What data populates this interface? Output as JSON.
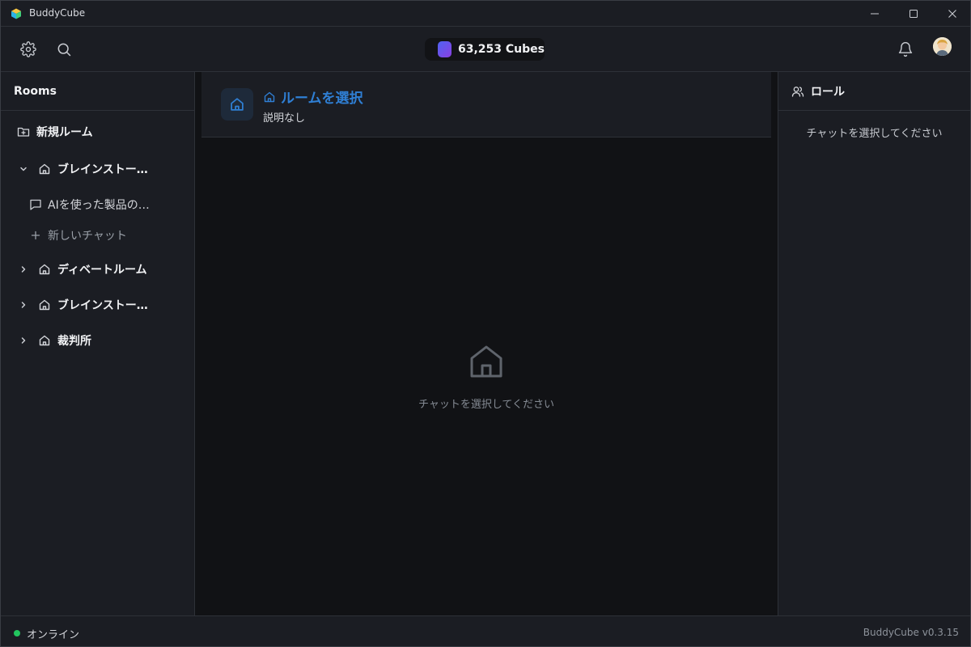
{
  "window": {
    "title": "BuddyCube"
  },
  "toolbar": {
    "cubes": "63,253 Cubes"
  },
  "sidebar": {
    "header": "Rooms",
    "new_room": "新規ルーム",
    "rooms": [
      {
        "name": "ブレインストー…",
        "expanded": true
      },
      {
        "name": "ディベートルーム",
        "expanded": false
      },
      {
        "name": "ブレインストー…",
        "expanded": false
      },
      {
        "name": "裁判所",
        "expanded": false
      }
    ],
    "chats": [
      {
        "label": "AIを使った製品の…"
      }
    ],
    "new_chat": "新しいチャット"
  },
  "room": {
    "title": "ルームを選択",
    "description": "説明なし",
    "empty_message": "チャットを選択してください"
  },
  "roles": {
    "title": "ロール",
    "empty_message": "チャットを選択してください"
  },
  "status": {
    "text": "オンライン",
    "color": "#22c55e",
    "version": "BuddyCube v0.3.15"
  },
  "colors": {
    "accent": "#2f7fd4",
    "background": "#1b1d23",
    "content": "#111215"
  }
}
